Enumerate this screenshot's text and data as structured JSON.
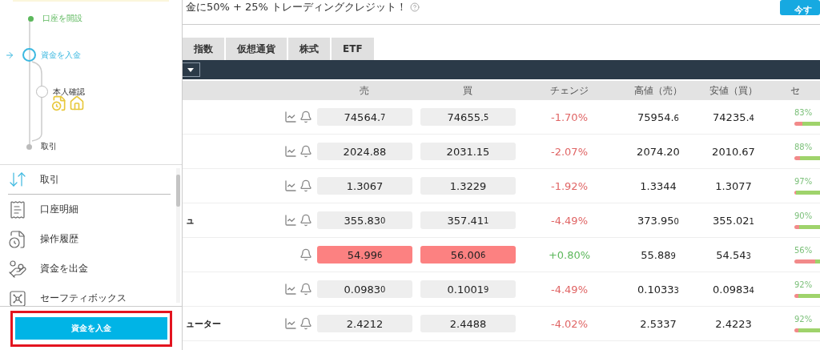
{
  "banner": {
    "text": "金に50% + 25% トレーディングクレジット！",
    "button": "今す"
  },
  "tabs": [
    {
      "label": "指数",
      "selected": false
    },
    {
      "label": "仮想通貨",
      "selected": false
    },
    {
      "label": "株式",
      "selected": false
    },
    {
      "label": "ETF",
      "selected": false
    }
  ],
  "table": {
    "columns": [
      "売",
      "買",
      "チェンジ",
      "高値（売）",
      "安値（買）",
      "セ"
    ],
    "rows": [
      {
        "name": "",
        "chart_icon": true,
        "highlight": false,
        "sell": {
          "main": "74564.",
          "tail": "7"
        },
        "buy": {
          "main": "74655.",
          "tail": "5"
        },
        "change": "-1.70%",
        "positive": false,
        "high": {
          "main": "75954.",
          "tail": "6"
        },
        "low": {
          "main": "74235.",
          "tail": "4"
        },
        "sentiment": {
          "pct": "83%",
          "level": 0.83
        }
      },
      {
        "name": "",
        "chart_icon": true,
        "highlight": false,
        "sell": {
          "main": "2024.88"
        },
        "buy": {
          "main": "2031.15"
        },
        "change": "-2.07%",
        "positive": false,
        "high": {
          "main": "2074.20"
        },
        "low": {
          "main": "2010.67"
        },
        "sentiment": {
          "pct": "88%",
          "level": 0.88
        }
      },
      {
        "name": "",
        "chart_icon": true,
        "highlight": false,
        "sell": {
          "main": "1.3067"
        },
        "buy": {
          "main": "1.3229"
        },
        "change": "-1.92%",
        "positive": false,
        "high": {
          "main": "1.3344"
        },
        "low": {
          "main": "1.3077"
        },
        "sentiment": {
          "pct": "97%",
          "level": 0.97
        }
      },
      {
        "name": "ュ",
        "chart_icon": true,
        "highlight": false,
        "sell": {
          "main": "355.83",
          "tail": "0"
        },
        "buy": {
          "main": "357.41",
          "tail": "1"
        },
        "change": "-4.49%",
        "positive": false,
        "high": {
          "main": "373.95",
          "tail": "0"
        },
        "low": {
          "main": "355.02",
          "tail": "1"
        },
        "sentiment": {
          "pct": "90%",
          "level": 0.9
        }
      },
      {
        "name": "",
        "chart_icon": false,
        "highlight": true,
        "sell": {
          "main": "54.99",
          "tail": "6"
        },
        "buy": {
          "main": "56.00",
          "tail": "6"
        },
        "change": "+0.80%",
        "positive": true,
        "high": {
          "main": "55.88",
          "tail": "9"
        },
        "low": {
          "main": "54.54",
          "tail": "3"
        },
        "sentiment": {
          "pct": "56%",
          "level": 0.56
        }
      },
      {
        "name": "",
        "chart_icon": true,
        "highlight": false,
        "sell": {
          "main": "0.0983",
          "tail": "0"
        },
        "buy": {
          "main": "0.1001",
          "tail": "9"
        },
        "change": "-4.49%",
        "positive": false,
        "high": {
          "main": "0.1033",
          "tail": "3"
        },
        "low": {
          "main": "0.0983",
          "tail": "4"
        },
        "sentiment": {
          "pct": "92%",
          "level": 0.92
        }
      },
      {
        "name": "ューター",
        "chart_icon": true,
        "highlight": false,
        "sell": {
          "main": "2.4212"
        },
        "buy": {
          "main": "2.4488"
        },
        "change": "-4.02%",
        "positive": false,
        "high": {
          "main": "2.5337"
        },
        "low": {
          "main": "2.4223"
        },
        "sentiment": {
          "pct": "92%",
          "level": 0.92
        }
      }
    ]
  },
  "panel": {
    "steps": [
      {
        "label": "口座を開設",
        "kind": "done"
      },
      {
        "label": "資金を入金",
        "kind": "current",
        "children": [
          {
            "label": "本人確認",
            "kind": "pending"
          }
        ]
      },
      {
        "label": "取引",
        "kind": "todo"
      }
    ],
    "menu": [
      {
        "label": "取引",
        "selected": true
      },
      {
        "label": "口座明細",
        "selected": false
      },
      {
        "label": "操作履歴",
        "selected": false
      },
      {
        "label": "資金を出金",
        "selected": false
      },
      {
        "label": "セーフティボックス",
        "selected": false
      }
    ],
    "deposit_button": "資金を入金"
  }
}
